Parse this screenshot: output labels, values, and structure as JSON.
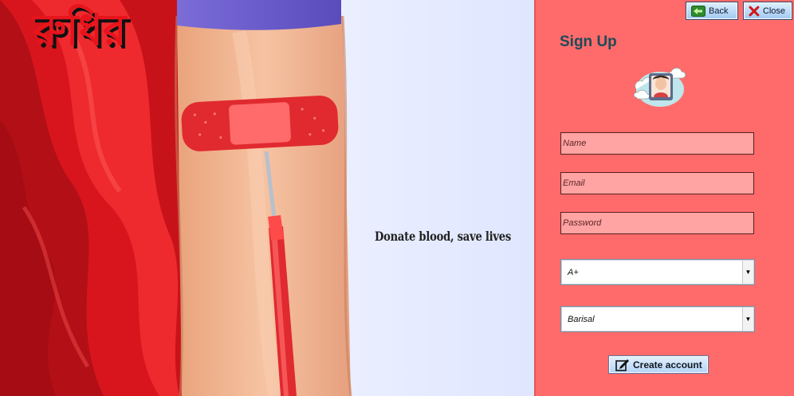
{
  "brand": {
    "logo_text": "রুধির",
    "tagline": "Donate blood, save lives"
  },
  "toolbar": {
    "back_label": "Back",
    "close_label": "Close"
  },
  "form": {
    "title": "Sign Up",
    "name_placeholder": "Name",
    "email_placeholder": "Email",
    "password_placeholder": "Password",
    "blood_group_value": "A+",
    "city_value": "Barisal",
    "create_button_label": "Create account"
  },
  "colors": {
    "panel_bg": "#ff6b6b",
    "field_bg": "#ffa3a3",
    "title": "#1d4a57",
    "brand_red": "#e8141c"
  },
  "icons": {
    "back": "back-arrow-icon",
    "close": "close-x-icon",
    "avatar": "user-avatar-icon",
    "create": "edit-icon",
    "dropdown": "chevron-down-icon"
  }
}
